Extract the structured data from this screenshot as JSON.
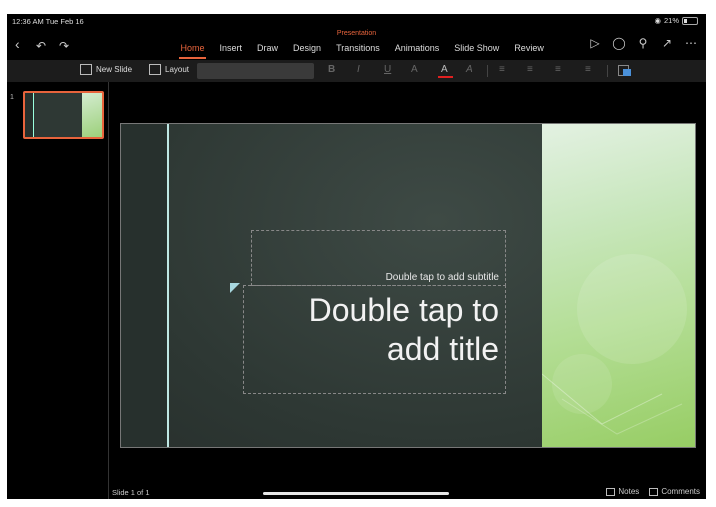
{
  "status": {
    "time": "12:36 AM  Tue Feb 16",
    "battery": "21%"
  },
  "app": {
    "doc_title": "Presentation"
  },
  "ribbon": {
    "tabs": [
      {
        "label": "Home",
        "active": true
      },
      {
        "label": "Insert"
      },
      {
        "label": "Draw"
      },
      {
        "label": "Design"
      },
      {
        "label": "Transitions"
      },
      {
        "label": "Animations"
      },
      {
        "label": "Slide Show"
      },
      {
        "label": "Review"
      }
    ],
    "icons": [
      "back-icon",
      "undo-icon",
      "redo-icon",
      "play-icon",
      "lightbulb-icon",
      "search-icon",
      "share-icon",
      "more-icon"
    ]
  },
  "toolbar": {
    "new_slide": "New Slide",
    "layout": "Layout",
    "font_name": "",
    "bold": "B",
    "italic": "I",
    "underline": "U",
    "highlight": "A",
    "font_color": "A",
    "clear_format": "A"
  },
  "slides_pane": {
    "items": [
      {
        "number": "1"
      }
    ]
  },
  "slide": {
    "subtitle_placeholder": "Double tap to add subtitle",
    "title_placeholder": "Double tap to\nadd title"
  },
  "bottom_bar": {
    "slide_counter": "Slide 1 of 1",
    "notes": "Notes",
    "comments": "Comments"
  },
  "colors": {
    "accent": "#e8643c",
    "slide_bg": "#2d3733",
    "slide_green": "#a4d67e"
  }
}
